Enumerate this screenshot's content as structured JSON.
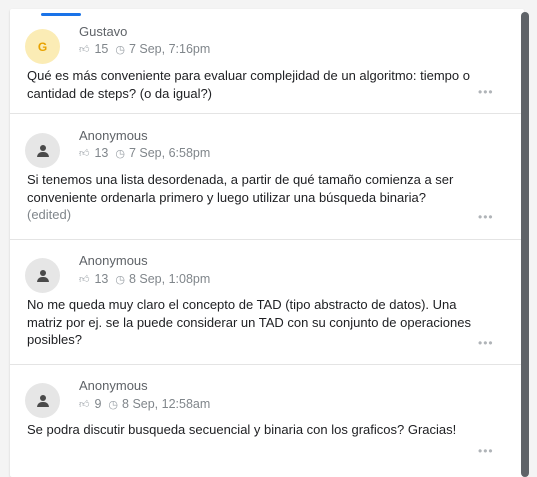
{
  "questions": [
    {
      "author": "Gustavo",
      "avatar_letter": "G",
      "avatar_type": "initial",
      "upvotes": "15",
      "date": "7 Sep, 7:16pm",
      "text": "Qué es más conveniente para evaluar complejidad de un algoritmo: tiempo o cantidad de steps? (o da igual?)",
      "edited": "",
      "more": "•••"
    },
    {
      "author": "Anonymous",
      "avatar_type": "anonymous",
      "upvotes": "13",
      "date": "7 Sep, 6:58pm",
      "text": "Si tenemos una lista desordenada, a partir de qué tamaño comienza a ser conveniente ordenarla primero y luego utilizar una búsqueda binaria?",
      "edited": "(edited)",
      "more": "•••"
    },
    {
      "author": "Anonymous",
      "avatar_type": "anonymous",
      "upvotes": "13",
      "date": "8 Sep, 1:08pm",
      "text": "No me queda muy claro el concepto de TAD (tipo abstracto de datos). Una matriz por ej. se la puede considerar un TAD con su conjunto de operaciones posibles?",
      "edited": "",
      "more": "•••"
    },
    {
      "author": "Anonymous",
      "avatar_type": "anonymous",
      "upvotes": "9",
      "date": "8 Sep, 12:58am",
      "text": "Se podra discutir busqueda secuencial y binaria con los graficos? Gracias!",
      "edited": "",
      "more": "•••"
    }
  ],
  "icons": {
    "upvote": "thumb-up-icon",
    "time": "clock-icon",
    "anonymous": "person-icon",
    "more": "more-horizontal-icon"
  },
  "colors": {
    "accent": "#1a73e8",
    "avatar_initial_bg": "#fbecb5",
    "avatar_initial_fg": "#e8a200"
  }
}
